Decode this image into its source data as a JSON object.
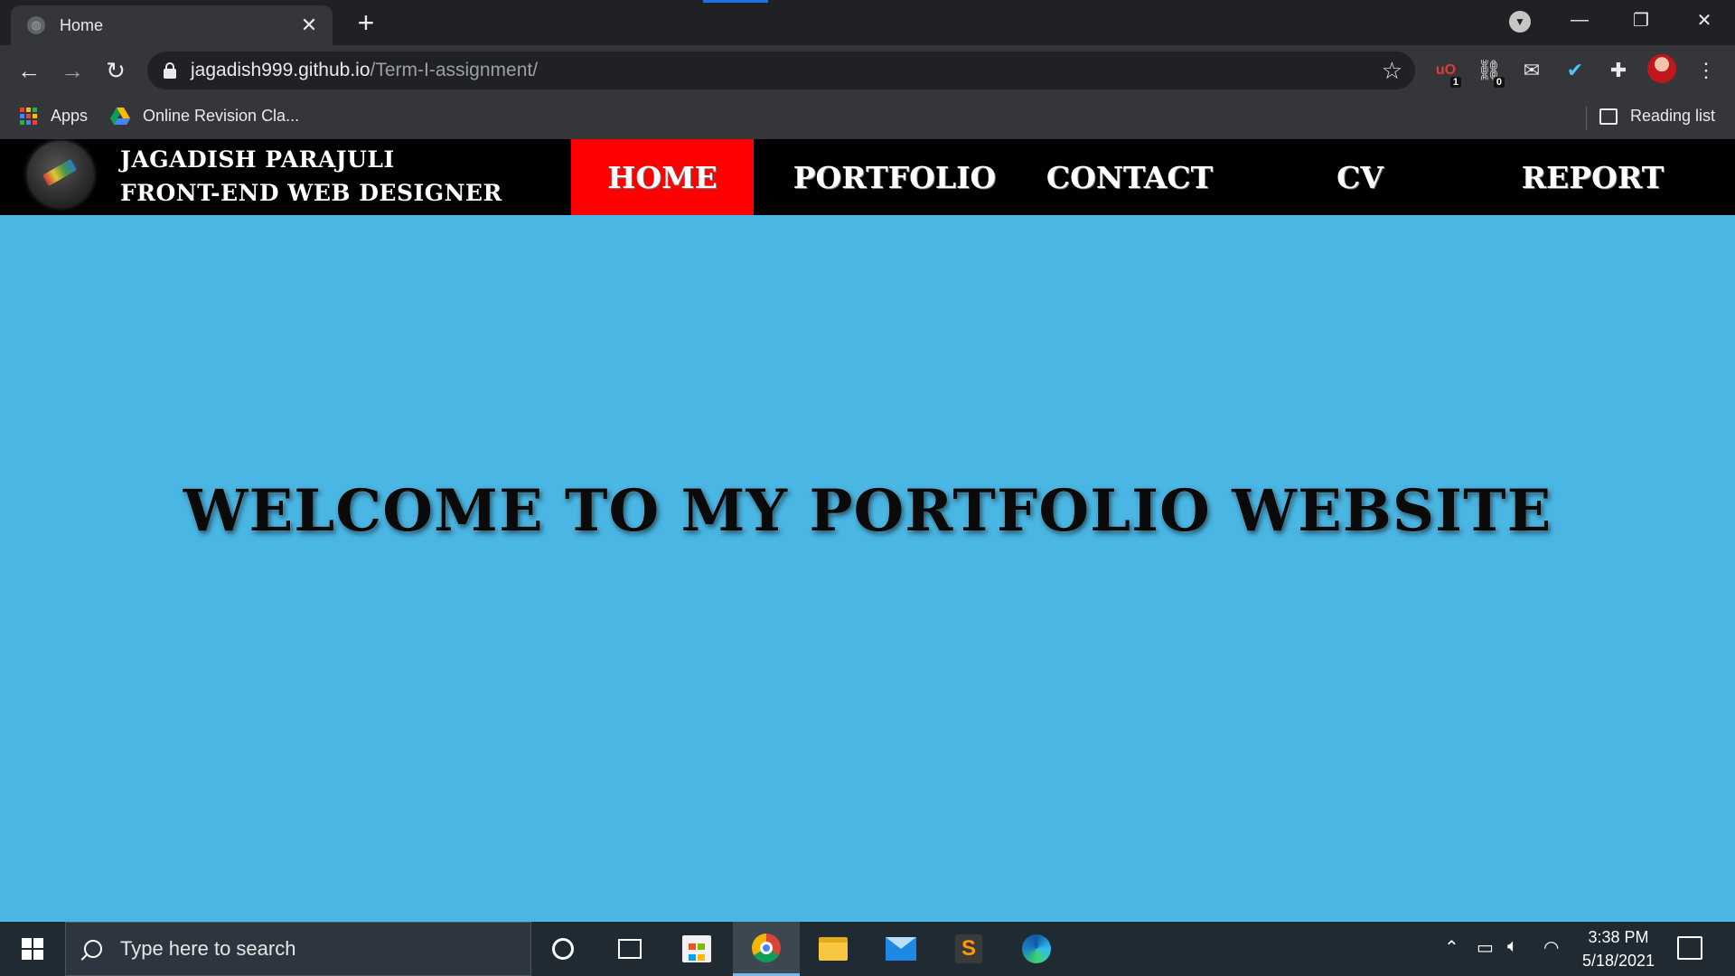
{
  "browser": {
    "tab": {
      "title": "Home",
      "close_glyph": "✕"
    },
    "new_tab_glyph": "+",
    "window_controls": {
      "minimize": "—",
      "maximize": "❐",
      "close": "✕"
    },
    "nav": {
      "back": "←",
      "forward": "→",
      "reload": "↻"
    },
    "url": {
      "host": "jagadish999.github.io",
      "path": "/Term-I-assignment/"
    },
    "extensions": [
      {
        "name": "ublock-icon",
        "badge": "1"
      },
      {
        "name": "link-extension-icon",
        "badge": "0"
      },
      {
        "name": "mail-extension-icon",
        "badge": ""
      },
      {
        "name": "check-extension-icon",
        "badge": ""
      },
      {
        "name": "puzzle-extensions-icon",
        "badge": ""
      }
    ],
    "bookmarks": [
      {
        "label": "Apps"
      },
      {
        "label": "Online Revision Cla..."
      }
    ],
    "reading_list": "Reading list"
  },
  "site": {
    "brand_line1": "JAGADISH PARAJULI",
    "brand_line2": "FRONT-END WEB DESIGNER",
    "nav": [
      {
        "label": "HOME",
        "active": true
      },
      {
        "label": "PORTFOLIO",
        "active": false
      },
      {
        "label": "CONTACT",
        "active": false
      },
      {
        "label": "CV",
        "active": false
      },
      {
        "label": "REPORT",
        "active": false
      }
    ],
    "welcome": "WELCOME TO MY PORTFOLIO WEBSITE",
    "colors": {
      "header_bg": "#000000",
      "active_nav": "#ff0000",
      "page_bg": "#4ab6e4"
    }
  },
  "taskbar": {
    "search_placeholder": "Type here to search",
    "time": "3:38 PM",
    "date": "5/18/2021"
  }
}
